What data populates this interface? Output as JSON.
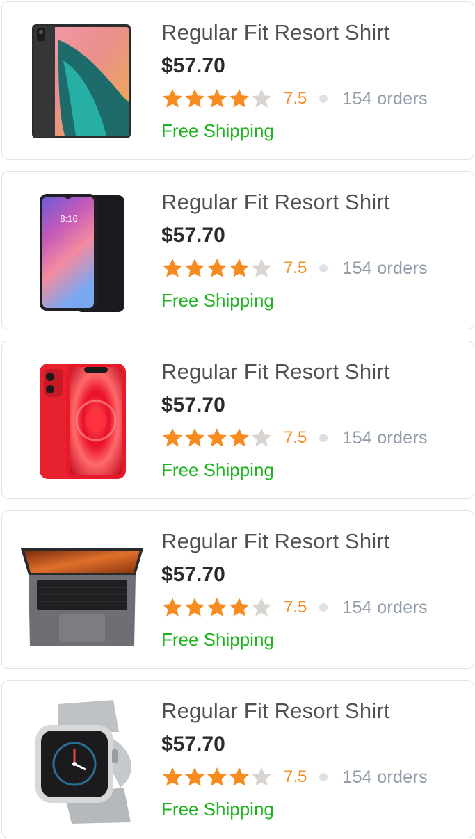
{
  "accent": {
    "star": "#f68b1f",
    "star_empty": "#d8d4cf",
    "shipping": "#1fb41f"
  },
  "products": [
    {
      "title": "Regular Fit Resort Shirt",
      "price": "$57.70",
      "rating": "7.5",
      "stars": 4,
      "orders": "154 orders",
      "shipping": "Free Shipping",
      "image": "tablet-image"
    },
    {
      "title": "Regular Fit Resort Shirt",
      "price": "$57.70",
      "rating": "7.5",
      "stars": 4,
      "orders": "154 orders",
      "shipping": "Free Shipping",
      "image": "android-phone-image",
      "image_text": "8:16"
    },
    {
      "title": "Regular Fit Resort Shirt",
      "price": "$57.70",
      "rating": "7.5",
      "stars": 4,
      "orders": "154 orders",
      "shipping": "Free Shipping",
      "image": "red-iphone-image"
    },
    {
      "title": "Regular Fit Resort Shirt",
      "price": "$57.70",
      "rating": "7.5",
      "stars": 4,
      "orders": "154 orders",
      "shipping": "Free Shipping",
      "image": "laptop-image"
    },
    {
      "title": "Regular Fit Resort Shirt",
      "price": "$57.70",
      "rating": "7.5",
      "stars": 4,
      "orders": "154 orders",
      "shipping": "Free Shipping",
      "image": "smartwatch-image"
    }
  ]
}
